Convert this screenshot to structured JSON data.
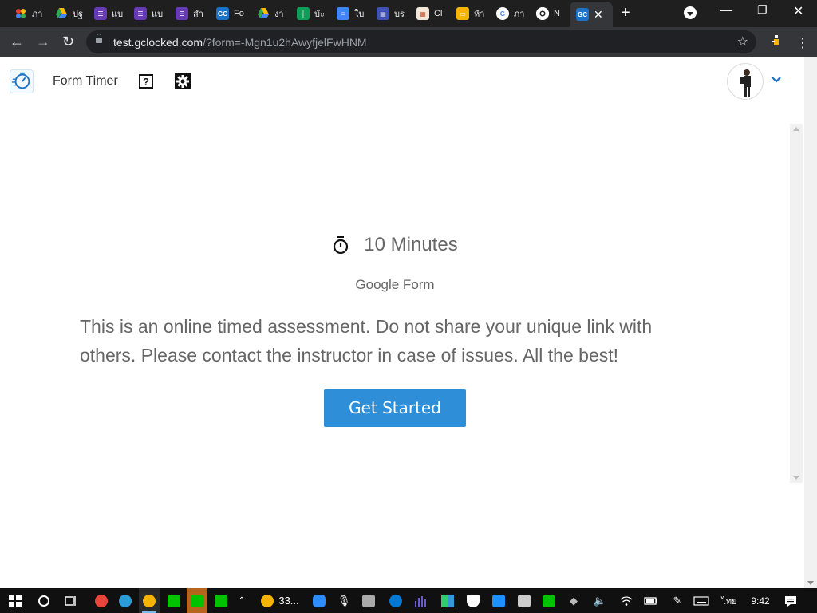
{
  "browser": {
    "tabs": [
      {
        "label": "ภา",
        "icon": "photos-icon",
        "color": "#ea4335"
      },
      {
        "label": "ปฐ",
        "icon": "drive-icon",
        "color": "#34a853"
      },
      {
        "label": "แบ",
        "icon": "forms-icon",
        "color": "#673ab7"
      },
      {
        "label": "แบ",
        "icon": "forms-icon",
        "color": "#673ab7"
      },
      {
        "label": "สำ",
        "icon": "forms-icon",
        "color": "#673ab7"
      },
      {
        "label": "Fo",
        "icon": "gc-icon",
        "color": "#1a73c8"
      },
      {
        "label": "งา",
        "icon": "drive-icon",
        "color": "#34a853"
      },
      {
        "label": "บัะ",
        "icon": "sheets-icon",
        "color": "#0f9d58"
      },
      {
        "label": "ใบ",
        "icon": "docs-icon",
        "color": "#4285f4"
      },
      {
        "label": "บร",
        "icon": "sites-icon",
        "color": "#3f51b5"
      },
      {
        "label": "Cl",
        "icon": "classroom-icon",
        "color": "#c5532a"
      },
      {
        "label": "ห้า",
        "icon": "slides-icon",
        "color": "#f4b400"
      },
      {
        "label": "ภา",
        "icon": "google-icon",
        "color": "#ffffff"
      },
      {
        "label": "N",
        "icon": "chrome-icon",
        "color": "#ffffff"
      },
      {
        "label": "GC",
        "icon": "gc-icon",
        "color": "#1a73c8",
        "active": true
      }
    ],
    "url_host": "test.gclocked.com",
    "url_path": "/?form=-Mgn1u2hAwyfjelFwHNM"
  },
  "header": {
    "title": "Form Timer",
    "help_symbol": "?"
  },
  "main": {
    "duration": "10 Minutes",
    "form_type": "Google Form",
    "description": "This is an online timed assessment. Do not share your unique link with others. Please contact the instructor in case of issues. All the best!",
    "start_button": "Get Started",
    "accent_color": "#2e8fd8"
  },
  "taskbar": {
    "weather": "33...",
    "language": "ไทย",
    "time": "9:42"
  }
}
